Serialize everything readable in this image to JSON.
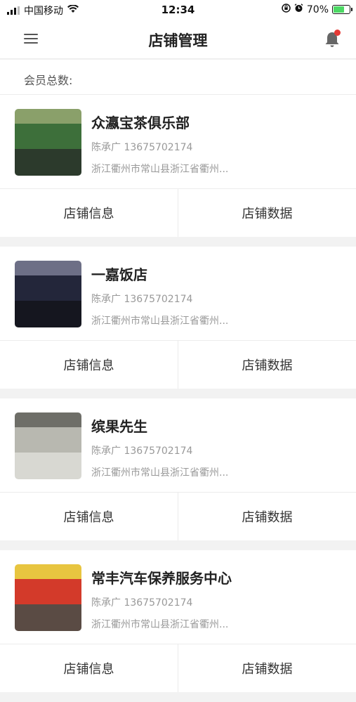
{
  "status_bar": {
    "carrier": "中国移动",
    "time": "12:34",
    "battery": "70%",
    "battery_level": 0.7
  },
  "nav": {
    "title": "店铺管理"
  },
  "member": {
    "label": "会员总数:"
  },
  "stores": [
    {
      "name": "众瀛宝茶俱乐部",
      "contact": "陈承广 13675702174",
      "address": "浙江衢州市常山县浙江省衢州...",
      "info_button": "店铺信息",
      "data_button": "店铺数据",
      "thumb_colors": [
        "#3d6f3a",
        "#8aa06a",
        "#2c3a2c"
      ]
    },
    {
      "name": "一嘉饭店",
      "contact": "陈承广 13675702174",
      "address": "浙江衢州市常山县浙江省衢州...",
      "info_button": "店铺信息",
      "data_button": "店铺数据",
      "thumb_colors": [
        "#23263a",
        "#6d6f86",
        "#15161f"
      ]
    },
    {
      "name": "缤果先生",
      "contact": "陈承广 13675702174",
      "address": "浙江衢州市常山县浙江省衢州...",
      "info_button": "店铺信息",
      "data_button": "店铺数据",
      "thumb_colors": [
        "#b8b8b0",
        "#6e6e68",
        "#d8d8d2"
      ]
    },
    {
      "name": "常丰汽车保养服务中心",
      "contact": "陈承广 13675702174",
      "address": "浙江衢州市常山县浙江省衢州...",
      "info_button": "店铺信息",
      "data_button": "店铺数据",
      "thumb_colors": [
        "#d33a2a",
        "#e8c540",
        "#5a4b44"
      ]
    }
  ]
}
